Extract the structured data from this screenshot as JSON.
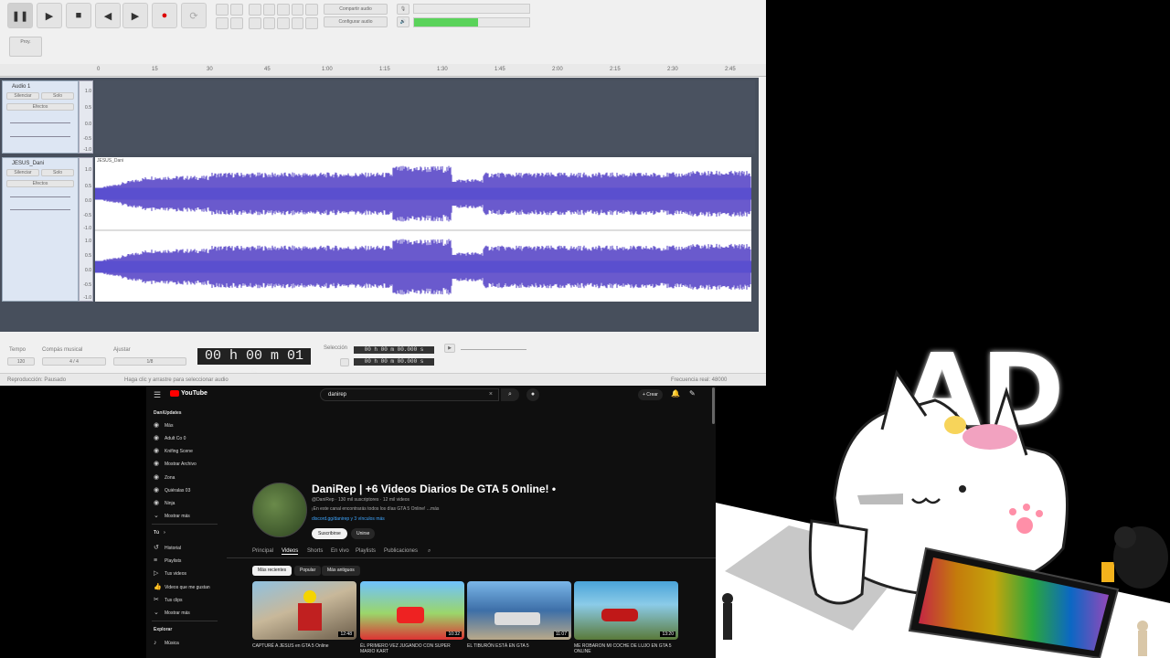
{
  "audacity": {
    "toolbar": {
      "pause": "❚❚",
      "play": "▶",
      "stop": "■",
      "skip_start": "◀",
      "skip_end": "▶",
      "record": "●",
      "loop": "⟳",
      "audio_setup": "Configurar audio",
      "share_audio": "Compartir audio",
      "edit_label": "Editar sonido",
      "project_rate_label": "Proy.",
      "meter_label": "L R"
    },
    "ruler": [
      "0",
      "15",
      "30",
      "45",
      "1:00",
      "1:15",
      "1:30",
      "1:45",
      "2:00",
      "2:15",
      "2:30",
      "2:45"
    ],
    "tracks": [
      {
        "name": "Audio 1",
        "btn1": "Silenciar",
        "btn2": "Solo",
        "btn3": "Efectos",
        "scale": [
          "1.0",
          "0.5",
          "0.0",
          "-0.5",
          "-1.0"
        ]
      },
      {
        "name": "JESUS_Dani",
        "btn1": "Silenciar",
        "btn2": "Solo",
        "btn3": "Efectos",
        "clip": "JESUS_Dani",
        "scale": [
          "1.0",
          "0.5",
          "0.0",
          "-0.5",
          "-1.0"
        ]
      }
    ],
    "bottom": {
      "tempo_label": "Tempo",
      "meter_label": "Compás musical",
      "snap_label": "Ajustar",
      "time_display": "00 h 00 m 01 s",
      "selection_label": "Selección",
      "sel_start": "00 h 00 m 00.000 s",
      "sel_end": "00 h 00 m 00.000 s"
    },
    "status": {
      "left": "Reproducción: Pausado",
      "middle": "Haga clic y arrastre para seleccionar audio",
      "right": "Frecuencia real: 48000"
    }
  },
  "youtube": {
    "logo": "YouTube",
    "search_value": "danirep",
    "create_label": "+ Crear",
    "sidebar": {
      "top": "DaniUpdates",
      "items": [
        "Más",
        "Adult Co 0",
        "Knifing Scene",
        "Mostrar Archivo",
        "Zona",
        "Quiéralas 03",
        "Ninja",
        "Mostrar más"
      ],
      "section": "Tú",
      "you_items": [
        "Historial",
        "Playlists",
        "Tus videos",
        "Videos que me gustan",
        "Tus clips",
        "Mostrar más"
      ],
      "explore": "Explorar",
      "explore_items": [
        "Música"
      ]
    },
    "channel": {
      "name": "DaniRep | +6 Videos Diarios De GTA 5 Online! •",
      "handle": "@DaniRep · 130 mil suscriptores · 12 mil videos",
      "desc": "¡En este canal encontrarás todos los días GTA 5 Online! ...más",
      "link": "discord.gg/danirep y 3 vínculos más",
      "subscribe": "Suscribirse",
      "join": "Unirse"
    },
    "tabs": [
      "Principal",
      "Videos",
      "Shorts",
      "En vivo",
      "Playlists",
      "Publicaciones"
    ],
    "chips": [
      "Más recientes",
      "Popular",
      "Más antiguos"
    ],
    "videos": [
      {
        "title": "CAPTURÉ A JESUS en GTA 5 Online",
        "time": "12:48"
      },
      {
        "title": "ÉL PRIMERO VEZ JUGANDO CON SUPER MARIO KART",
        "time": "10:32"
      },
      {
        "title": "EL TIBURÓN ESTÁ EN GTA 5",
        "time": "11:07"
      },
      {
        "title": "ME ROBARON MI COCHE DE LUJO EN GTA 5 ONLINE",
        "time": "13:20"
      }
    ]
  },
  "overlay": {
    "logo_text": "AD"
  }
}
